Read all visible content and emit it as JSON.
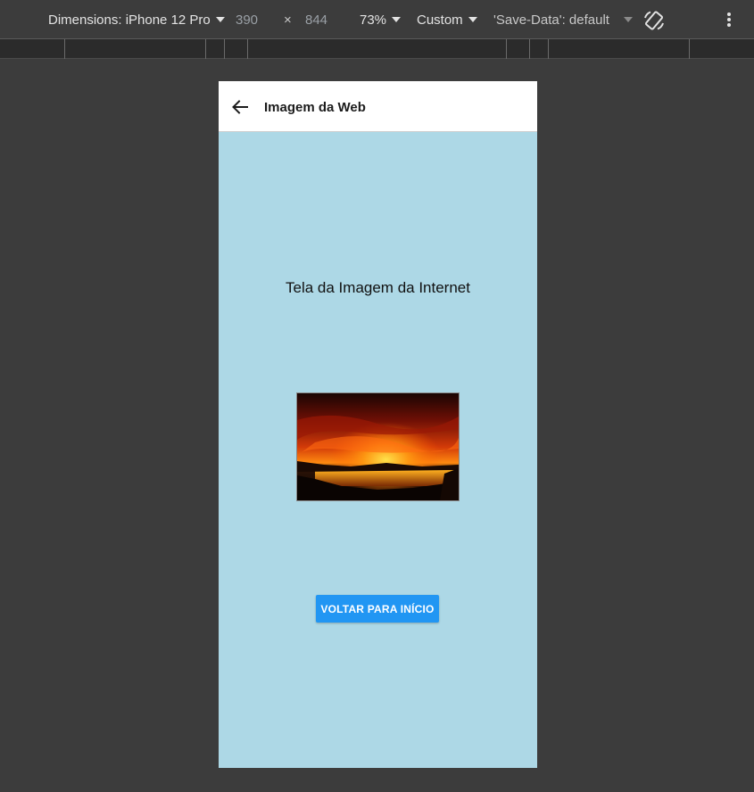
{
  "devtools": {
    "device_label": "Dimensions: iPhone 12 Pro",
    "width": "390",
    "times": "×",
    "height": "844",
    "zoom": "73%",
    "throttle": "Custom",
    "save_data": "'Save-Data': default",
    "icons": {
      "rotate": "rotate-icon",
      "more": "more-vert-icon"
    }
  },
  "app": {
    "title": "Imagem da Web",
    "back_icon": "arrow-back-icon",
    "body_text": "Tela da Imagem da Internet",
    "image_description_icon": "sunset-image",
    "button_label": "VOLTAR PARA INÍCIO",
    "colors": {
      "background": "#add8e6",
      "appbar": "#ffffff",
      "button": "#2196f3",
      "button_text": "#ffffff"
    }
  }
}
